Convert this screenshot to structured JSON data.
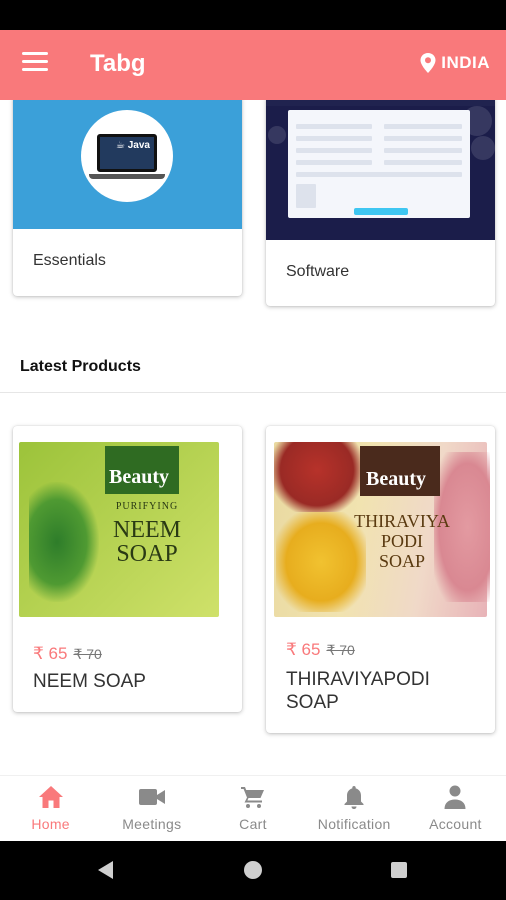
{
  "app": {
    "title": "Tabg",
    "location": "INDIA"
  },
  "categories": [
    {
      "label": "Essentials",
      "image_icon": "java-laptop-image"
    },
    {
      "label": "Software",
      "image_icon": "software-form-screenshot"
    }
  ],
  "latest": {
    "title": "Latest Products",
    "products": [
      {
        "name": "NEEM SOAP",
        "price": "₹ 65",
        "old_price": "₹ 70",
        "box": {
          "brand": "Beauty",
          "text": [
            "PURIFYING",
            "NEEM",
            "SOAP"
          ]
        }
      },
      {
        "name": "THIRAVIYAPODI SOAP",
        "price": "₹ 65",
        "old_price": "₹ 70",
        "box": {
          "brand": "Beauty",
          "text": [
            "THIRAVIYA",
            "PODI",
            "SOAP"
          ]
        }
      }
    ]
  },
  "bottom_nav": [
    {
      "label": "Home",
      "icon": "home-icon",
      "active": true
    },
    {
      "label": "Meetings",
      "icon": "video-camera-icon",
      "active": false
    },
    {
      "label": "Cart",
      "icon": "cart-icon",
      "active": false
    },
    {
      "label": "Notification",
      "icon": "bell-icon",
      "active": false
    },
    {
      "label": "Account",
      "icon": "person-icon",
      "active": false
    }
  ],
  "colors": {
    "accent": "#f9797b",
    "inactive": "#8a8a8a"
  }
}
